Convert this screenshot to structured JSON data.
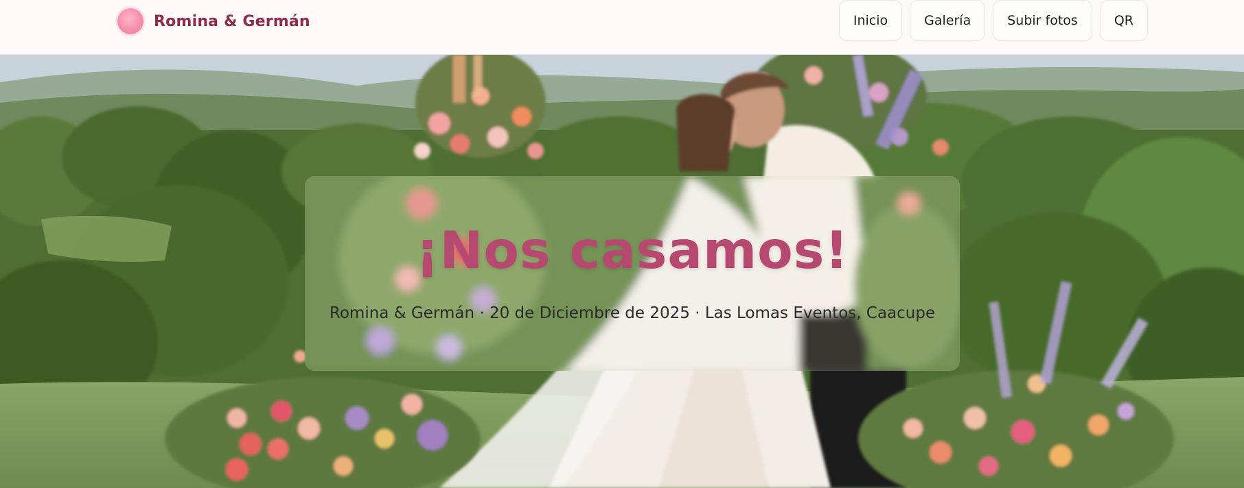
{
  "site": {
    "brand": "Romina & Germán"
  },
  "nav": {
    "items": [
      {
        "label": "Inicio"
      },
      {
        "label": "Galería"
      },
      {
        "label": "Subir fotos"
      },
      {
        "label": "QR"
      }
    ]
  },
  "hero": {
    "title": "¡Nos casamos!",
    "subtitle": "Romina & Germán · 20 de Diciembre de 2025 · Las Lomas Eventos, Caacupe",
    "image": "wedding-kiss-photo"
  },
  "colors": {
    "brand_text": "#8e2c4e",
    "title_pink": "#b5496f",
    "header_bg": "#fffaf9",
    "logo_pink": "#f58fae"
  }
}
